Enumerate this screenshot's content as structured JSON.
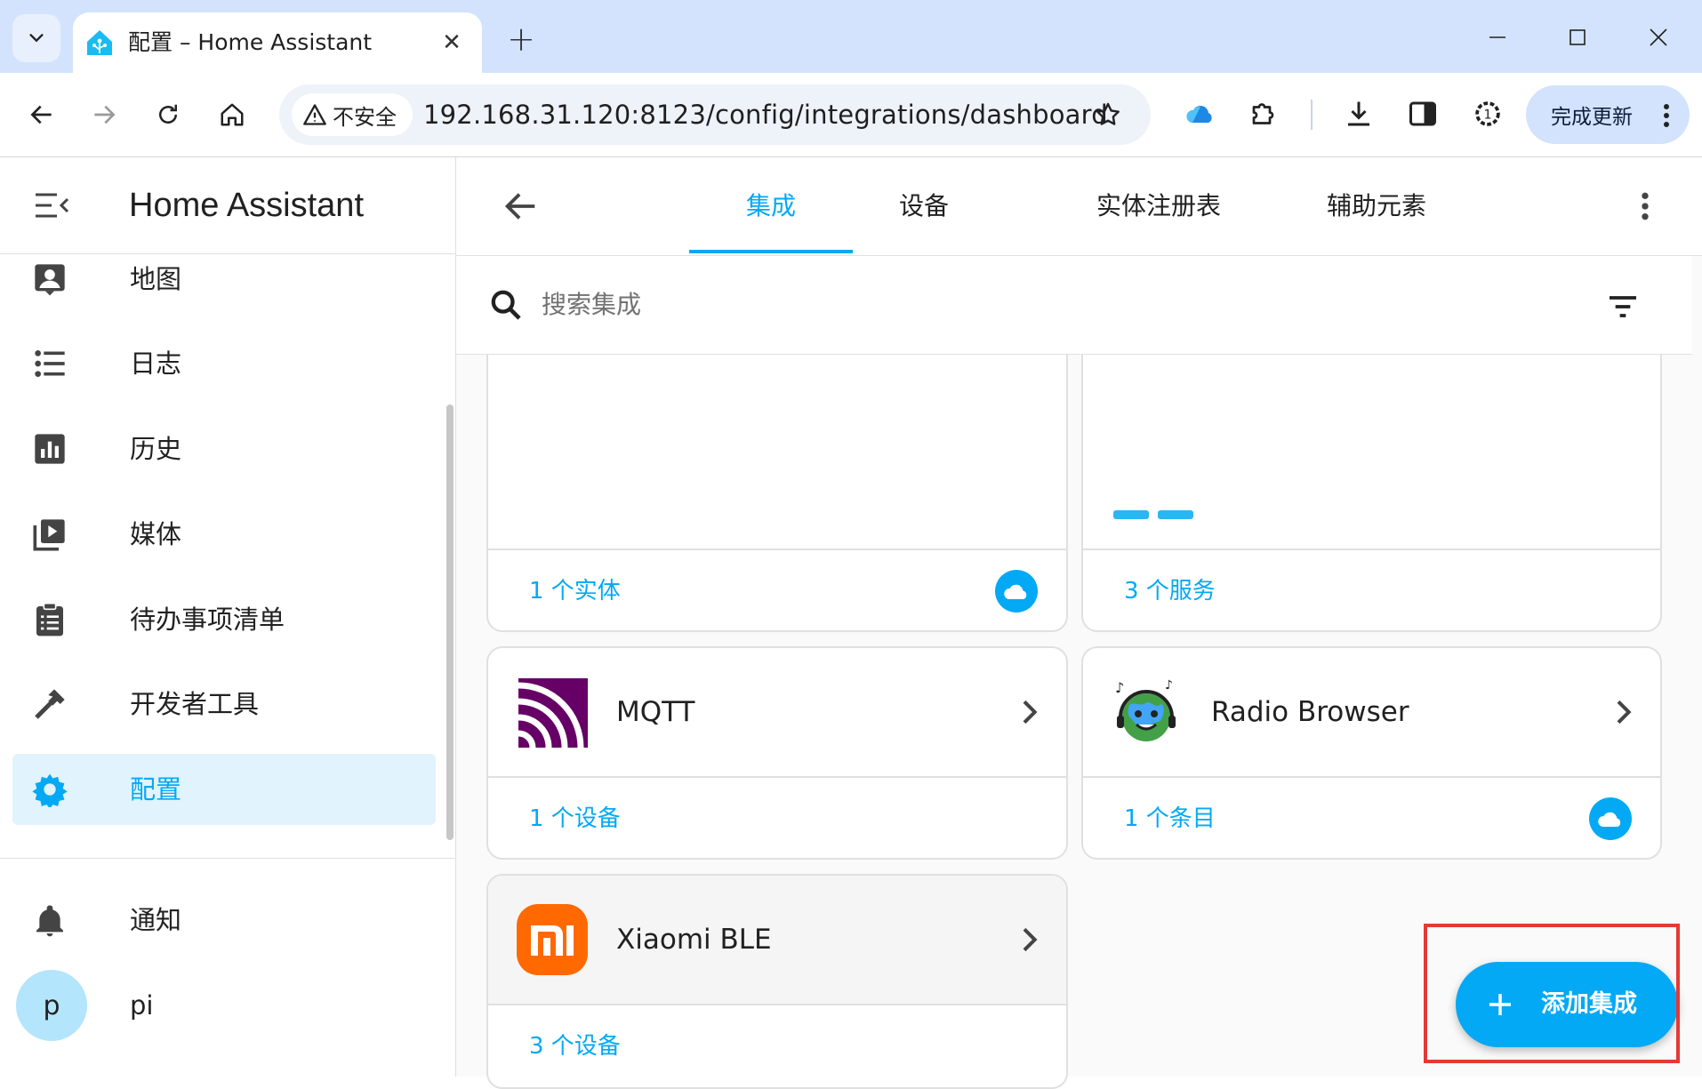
{
  "browser": {
    "tab_title": "配置 – Home Assistant",
    "security_label": "不安全",
    "url": "192.168.31.120:8123/config/integrations/dashboard",
    "update_button": "完成更新"
  },
  "sidebar": {
    "title": "Home Assistant",
    "items": [
      {
        "label": "地图",
        "icon": "account-box-icon"
      },
      {
        "label": "日志",
        "icon": "format-list-bulleted-icon"
      },
      {
        "label": "历史",
        "icon": "chart-box-icon"
      },
      {
        "label": "媒体",
        "icon": "play-box-multiple-icon"
      },
      {
        "label": "待办事项清单",
        "icon": "clipboard-list-icon"
      },
      {
        "label": "开发者工具",
        "icon": "hammer-icon"
      },
      {
        "label": "配置",
        "icon": "cog-icon",
        "active": true
      }
    ],
    "notifications_label": "通知",
    "user": {
      "initial": "p",
      "name": "pi"
    }
  },
  "main": {
    "tabs": [
      {
        "label": "集成",
        "active": true
      },
      {
        "label": "设备"
      },
      {
        "label": "实体注册表"
      },
      {
        "label": "辅助元素"
      }
    ],
    "search_placeholder": "搜索集成",
    "cards": [
      {
        "name": "",
        "footer": "1 个实体",
        "cloud": true
      },
      {
        "name": "",
        "footer": "3 个服务",
        "cloud": false
      },
      {
        "name": "MQTT",
        "footer": "1 个设备",
        "cloud": false,
        "logo": "mqtt-logo"
      },
      {
        "name": "Radio Browser",
        "footer": "1 个条目",
        "cloud": true,
        "logo": "radio-browser-logo"
      },
      {
        "name": "Xiaomi BLE",
        "footer": "3 个设备",
        "cloud": false,
        "logo": "xiaomi-logo"
      }
    ],
    "fab_label": "添加集成"
  },
  "colors": {
    "accent": "#03a9f4",
    "active_bg": "#e1f3fd",
    "chrome_tab_strip": "#d3e3fd",
    "mqtt": "#660066",
    "xiaomi": "#ff6900",
    "highlight": "#e53935"
  }
}
